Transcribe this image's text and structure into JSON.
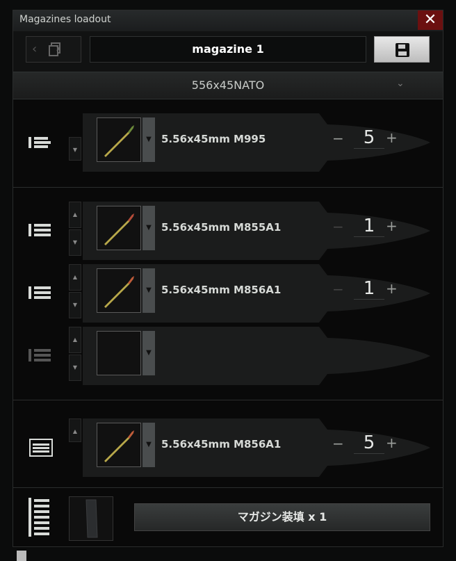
{
  "window": {
    "title": "Magazines loadout",
    "close_glyph": "✕"
  },
  "toolbar": {
    "magazine_name": "magazine 1"
  },
  "caliber": {
    "selected": "556x45NATO"
  },
  "rows": [
    {
      "ammo": "5.56x45mm M995",
      "count": "5",
      "plus": "+",
      "minus": "−"
    },
    {
      "ammo": "5.56x45mm M855A1",
      "count": "1",
      "plus": "+",
      "minus": "−"
    },
    {
      "ammo": "5.56x45mm M856A1",
      "count": "1",
      "plus": "+",
      "minus": "−"
    },
    {
      "ammo": "",
      "count": "",
      "plus": "",
      "minus": ""
    },
    {
      "ammo": "5.56x45mm M856A1",
      "count": "5",
      "plus": "+",
      "minus": "−"
    }
  ],
  "load_button": "マガジン装填 x 1",
  "colors": {
    "accent_close": "#6b1010",
    "save_button": "#d8d8d8"
  },
  "icons": [
    "chevron-left-icon",
    "copy-icon",
    "save-icon",
    "chevron-down-icon",
    "ammo-stack-icon",
    "bullet-icon",
    "magazine-icon"
  ]
}
